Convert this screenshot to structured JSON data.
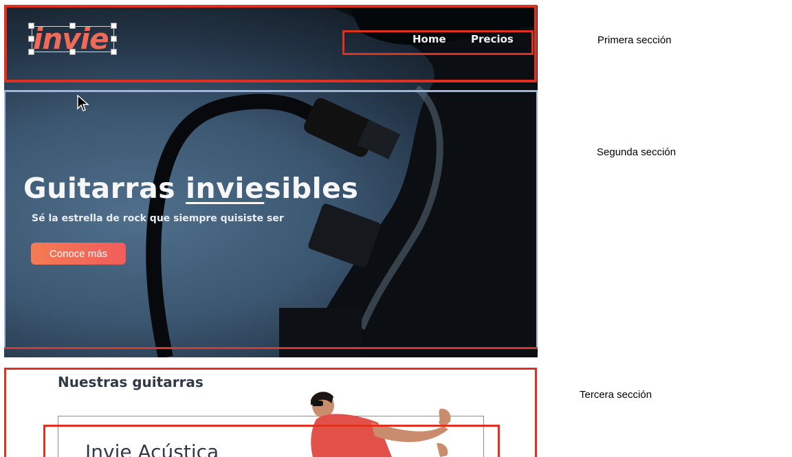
{
  "header": {
    "logo_text": "invie",
    "nav": [
      {
        "label": "Home"
      },
      {
        "label": "Precios"
      }
    ]
  },
  "hero": {
    "title_part1": "Guitarras ",
    "title_underlined": "invie",
    "title_part2": "sibles",
    "subtitle": "Sé la estrella de rock que siempre quisiste ser",
    "cta_label": "Conoce más"
  },
  "products": {
    "section_title": "Nuestras guitarras",
    "card_title": "Invie Acústica"
  },
  "annotations": [
    {
      "label": "Primera sección"
    },
    {
      "label": "Segunda sección"
    },
    {
      "label": "Tercera sección"
    }
  ],
  "colors": {
    "section_outline": "#e0301f",
    "selection_outline": "#9fb6d8",
    "brand": "#f06a5a",
    "cta_gradient_start": "#f47b52",
    "cta_gradient_end": "#f15c5c"
  }
}
